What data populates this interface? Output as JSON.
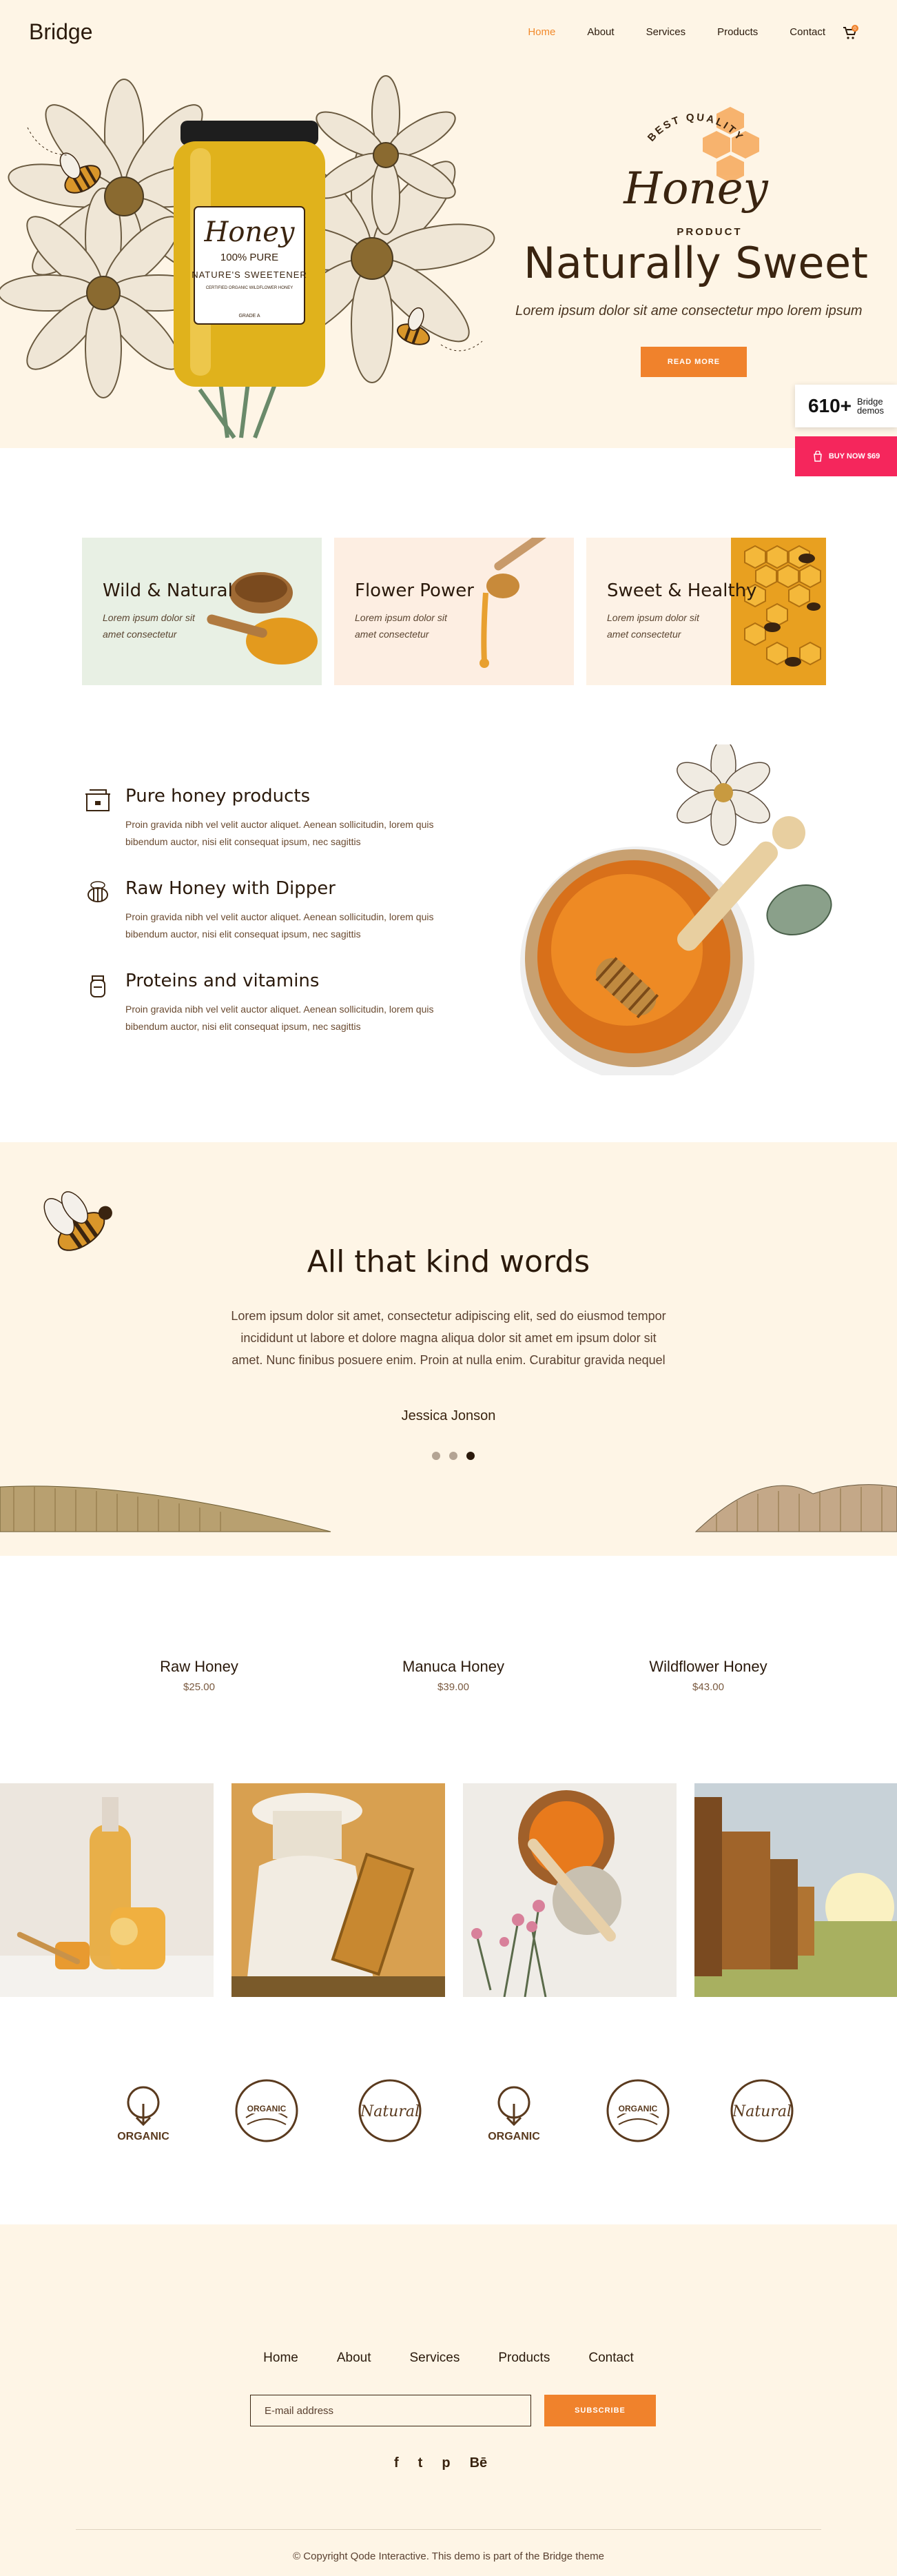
{
  "header": {
    "logo": "Bridge",
    "nav": [
      "Home",
      "About",
      "Services",
      "Products",
      "Contact"
    ],
    "cart_count": "0"
  },
  "hero": {
    "badge_top": "BEST QUALITY",
    "badge_word": "Honey",
    "badge_bottom": "PRODUCT",
    "jar_brand": "Honey",
    "jar_pure": "100% PURE",
    "jar_sweet": "NATURE'S SWEETENER",
    "jar_small": "CERTIFIED ORGANIC WILDFLOWER HONEY",
    "jar_grade": "GRADE A",
    "title": "Naturally Sweet",
    "subtitle": "Lorem ipsum dolor sit ame consectetur mpo lorem ipsum",
    "button": "READ MORE"
  },
  "side": {
    "count": "610+",
    "count_label_1": "Bridge",
    "count_label_2": "demos",
    "buy": "BUY NOW $69"
  },
  "cards": [
    {
      "title": "Wild & Natural",
      "text": "Lorem ipsum dolor sit amet consectetur",
      "bg": "#e8f0e4"
    },
    {
      "title": "Flower Power",
      "text": "Lorem ipsum dolor sit amet consectetur",
      "bg": "#fdeee2"
    },
    {
      "title": "Sweet & Healthy",
      "text": "Lorem ipsum dolor sit amet consectetur",
      "bg": "#fdf2e6"
    }
  ],
  "features": [
    {
      "title": "Pure honey products",
      "text": "Proin gravida nibh vel velit auctor aliquet. Aenean sollicitudin, lorem quis bibendum auctor, nisi elit consequat ipsum, nec sagittis"
    },
    {
      "title": "Raw Honey with Dipper",
      "text": "Proin gravida nibh vel velit auctor aliquet. Aenean sollicitudin, lorem quis bibendum auctor, nisi elit consequat ipsum, nec sagittis"
    },
    {
      "title": "Proteins and vitamins",
      "text": "Proin gravida nibh vel velit auctor aliquet. Aenean sollicitudin, lorem quis bibendum auctor, nisi elit consequat ipsum, nec sagittis"
    }
  ],
  "testimonial": {
    "title": "All that kind words",
    "quote": "Lorem ipsum dolor sit amet, consectetur adipiscing elit, sed do eiusmod tempor incididunt ut labore et dolore magna aliqua dolor sit amet em ipsum dolor sit amet. Nunc finibus posuere enim. Proin at nulla enim. Curabitur gravida nequel",
    "name": "Jessica Jonson",
    "active_slide": 3
  },
  "products": [
    {
      "name": "Raw Honey",
      "price": "$25.00"
    },
    {
      "name": "Manuca Honey",
      "price": "$39.00"
    },
    {
      "name": "Wildflower Honey",
      "price": "$43.00"
    }
  ],
  "badges": [
    "ORGANIC",
    "ORGANIC",
    "Natural",
    "ORGANIC",
    "ORGANIC",
    "Natural"
  ],
  "footer": {
    "nav": [
      "Home",
      "About",
      "Services",
      "Products",
      "Contact"
    ],
    "email_placeholder": "E-mail address",
    "subscribe": "SUBSCRIBE",
    "social": [
      "f",
      "t",
      "p",
      "Bē"
    ],
    "copyright": "© Copyright Qode Interactive. This demo is part of the Bridge theme"
  },
  "colors": {
    "accent": "#f0822c",
    "cream": "#fef5e6",
    "brown": "#3a2410",
    "pink": "#f5265c"
  }
}
